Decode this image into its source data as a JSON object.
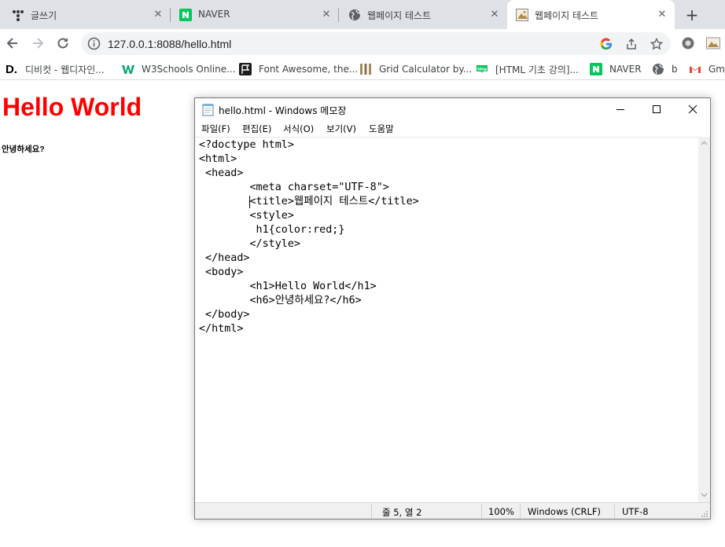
{
  "browser": {
    "tabs": [
      {
        "title": "글쓰기",
        "icon": "tistory-icon"
      },
      {
        "title": "NAVER",
        "icon": "naver-icon"
      },
      {
        "title": "웹페이지 테스트",
        "icon": "globe-icon"
      },
      {
        "title": "웹페이지 테스트",
        "icon": "page-thumbnail-icon",
        "active": true
      }
    ],
    "new_tab_label": "+",
    "url": "127.0.0.1:8088/hello.html",
    "bookmarks": [
      {
        "label": "디비컷 - 웹디자인...",
        "icon": "d-logo-icon"
      },
      {
        "label": "W3Schools Online...",
        "icon": "w3-logo-icon"
      },
      {
        "label": "Font Awesome, the...",
        "icon": "flag-icon"
      },
      {
        "label": "Grid Calculator by...",
        "icon": "grid-icon"
      },
      {
        "label": "[HTML 기초 강의]...",
        "icon": "blog-icon"
      },
      {
        "label": "NAVER",
        "icon": "naver-icon"
      },
      {
        "label": "b",
        "icon": "globe-icon"
      },
      {
        "label": "Gm",
        "icon": "gmail-icon"
      }
    ],
    "colors": {
      "tabstrip": "#dee1e6",
      "omnibox": "#f1f3f4"
    }
  },
  "page": {
    "h1": "Hello World",
    "h6": "안녕하세요?",
    "h1_color": "#ff0000"
  },
  "notepad": {
    "title": "hello.html - Windows 메모장",
    "menu": [
      "파일(F)",
      "편집(E)",
      "서식(O)",
      "보기(V)",
      "도움말"
    ],
    "code_lines": [
      "<?doctype html>",
      "<html>",
      " <head>",
      "        <meta charset=\"UTF-8\">",
      "        <title>웹페이지 테스트</title>",
      "        <style>",
      "         h1{color:red;}",
      "        </style>",
      " </head>",
      " <body>",
      "        <h1>Hello World</h1>",
      "        <h6>안녕하세요?</h6>",
      " </body>",
      "</html>"
    ],
    "status": {
      "position": "줄 5, 열 2",
      "zoom": "100%",
      "line_ending": "Windows (CRLF)",
      "encoding": "UTF-8"
    }
  }
}
